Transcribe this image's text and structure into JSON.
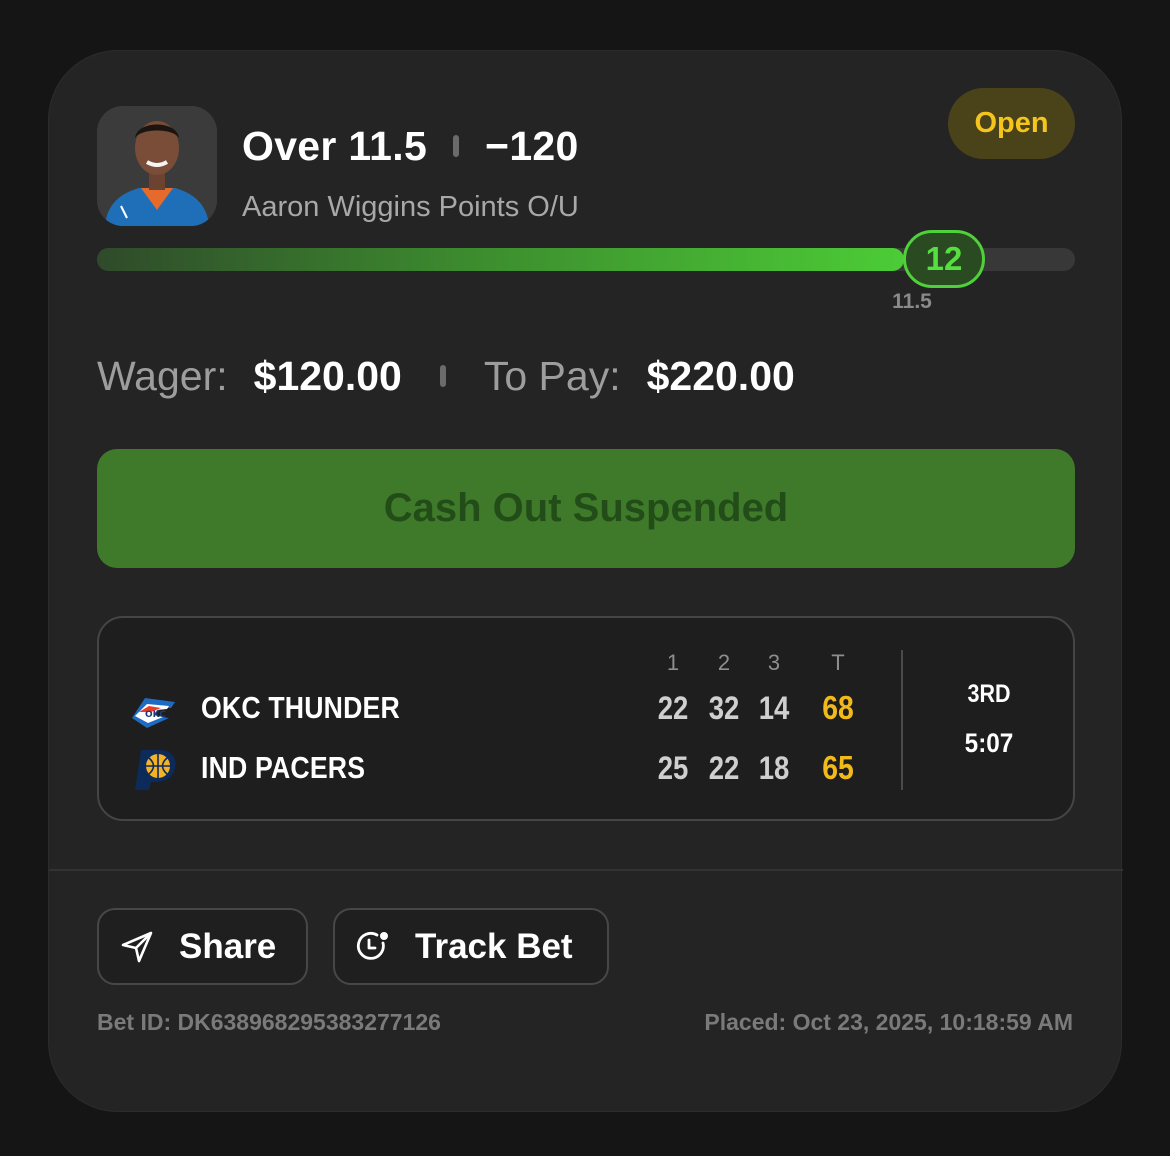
{
  "bet": {
    "selection": "Over 11.5",
    "odds": "−120",
    "market": "Aaron Wiggins Points O/U",
    "status": "Open",
    "progress": {
      "current_label": "12",
      "current": 12,
      "line_label": "11.5",
      "line": 11.5,
      "fill_fraction": 0.835
    },
    "wager_label": "Wager:",
    "wager_value": "$120.00",
    "to_pay_label": "To Pay:",
    "to_pay_value": "$220.00",
    "cashout_label": "Cash Out Suspended"
  },
  "scoreboard": {
    "periods": [
      "1",
      "2",
      "3",
      "T"
    ],
    "teams": [
      {
        "name": "OKC THUNDER",
        "logo": "okc-thunder-logo",
        "scores": [
          "22",
          "32",
          "14"
        ],
        "total": "68"
      },
      {
        "name": "IND PACERS",
        "logo": "ind-pacers-logo",
        "scores": [
          "25",
          "22",
          "18"
        ],
        "total": "65"
      }
    ],
    "period": "3RD",
    "clock": "5:07"
  },
  "actions": {
    "share_label": "Share",
    "share_icon": "send-icon",
    "track_label": "Track Bet",
    "track_icon": "track-icon"
  },
  "footer": {
    "bet_id": "Bet ID: DK638968295383277126",
    "placed": "Placed: Oct 23, 2025, 10:18:59 AM"
  },
  "colors": {
    "accent_green": "#4fd13a",
    "cashout_bg": "#3f7a2b",
    "status_yellow": "#f3c51d",
    "total_orange": "#f2b91b"
  }
}
